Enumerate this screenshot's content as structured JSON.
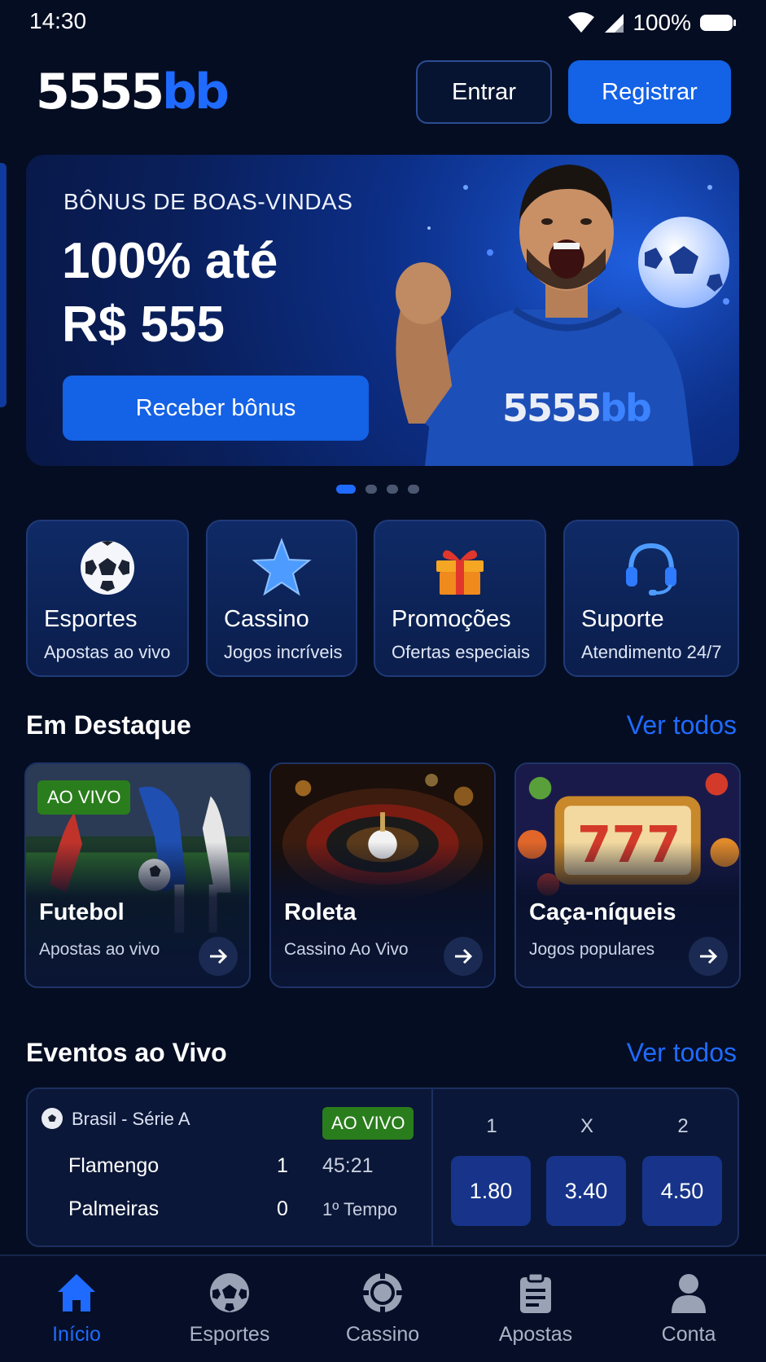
{
  "status_bar": {
    "time": "14:30",
    "battery": "100%"
  },
  "header": {
    "logo_white": "5555",
    "logo_blue": "bb",
    "login_label": "Entrar",
    "register_label": "Registrar"
  },
  "banner": {
    "kicker": "BÔNUS DE BOAS-VINDAS",
    "headline_line1": "100% até",
    "headline_line2": "R$ 555",
    "cta_label": "Receber bônus",
    "shirt_logo_white": "5555",
    "shirt_logo_blue": "bb",
    "slide_count": 4,
    "active_slide": 1
  },
  "categories": [
    {
      "title": "Esportes",
      "subtitle": "Apostas ao vivo",
      "icon": "soccer-ball-icon"
    },
    {
      "title": "Cassino",
      "subtitle": "Jogos incríveis",
      "icon": "star-icon"
    },
    {
      "title": "Promoções",
      "subtitle": "Ofertas especiais",
      "icon": "gift-icon"
    },
    {
      "title": "Suporte",
      "subtitle": "Atendimento 24/7",
      "icon": "headset-icon"
    }
  ],
  "featured": {
    "title": "Em Destaque",
    "see_all": "Ver todos",
    "items": [
      {
        "title": "Futebol",
        "subtitle": "Apostas ao vivo",
        "badge": "AO VIVO"
      },
      {
        "title": "Roleta",
        "subtitle": "Cassino Ao Vivo"
      },
      {
        "title": "Caça-níqueis",
        "subtitle": "Jogos populares"
      }
    ]
  },
  "live_events": {
    "title": "Eventos ao Vivo",
    "see_all": "Ver todos",
    "event": {
      "league": "Brasil - Série A",
      "badge": "AO VIVO",
      "home_team": "Flamengo",
      "home_score": "1",
      "away_team": "Palmeiras",
      "away_score": "0",
      "clock": "45:21",
      "period": "1º Tempo",
      "odds": [
        {
          "label": "1",
          "value": "1.80"
        },
        {
          "label": "X",
          "value": "3.40"
        },
        {
          "label": "2",
          "value": "4.50"
        }
      ]
    }
  },
  "bottom_nav": [
    {
      "label": "Início",
      "icon": "home-icon",
      "active": true
    },
    {
      "label": "Esportes",
      "icon": "soccer-ball-icon",
      "active": false
    },
    {
      "label": "Cassino",
      "icon": "casino-chip-icon",
      "active": false
    },
    {
      "label": "Apostas",
      "icon": "clipboard-icon",
      "active": false
    },
    {
      "label": "Conta",
      "icon": "user-icon",
      "active": false
    }
  ],
  "colors": {
    "background": "#050d22",
    "accent": "#1f6bff",
    "primary_button": "#1462e6",
    "live_badge": "#2a7d1c",
    "odd_button": "#17348a"
  }
}
